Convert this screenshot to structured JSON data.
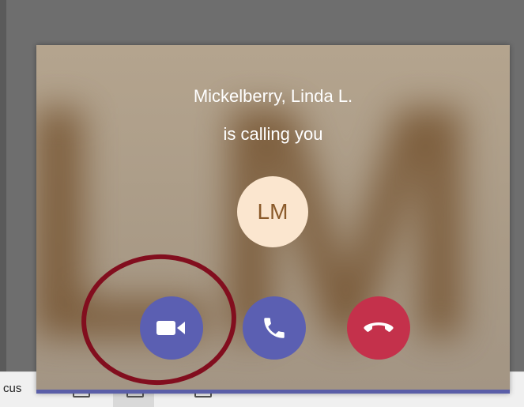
{
  "call": {
    "caller_name": "Mickelberry, Linda L.",
    "subtitle": "is calling you",
    "avatar_initials": "LM",
    "background_initials": "LM"
  },
  "buttons": {
    "video": "video-camera-icon",
    "audio": "phone-icon",
    "decline": "hang-up-icon"
  },
  "taskbar": {
    "partial_label": "cus"
  },
  "colors": {
    "accent": "#5b5fb2",
    "decline": "#c4314b",
    "avatar_bg": "#fbe6cf",
    "annotation": "#820e1e"
  }
}
